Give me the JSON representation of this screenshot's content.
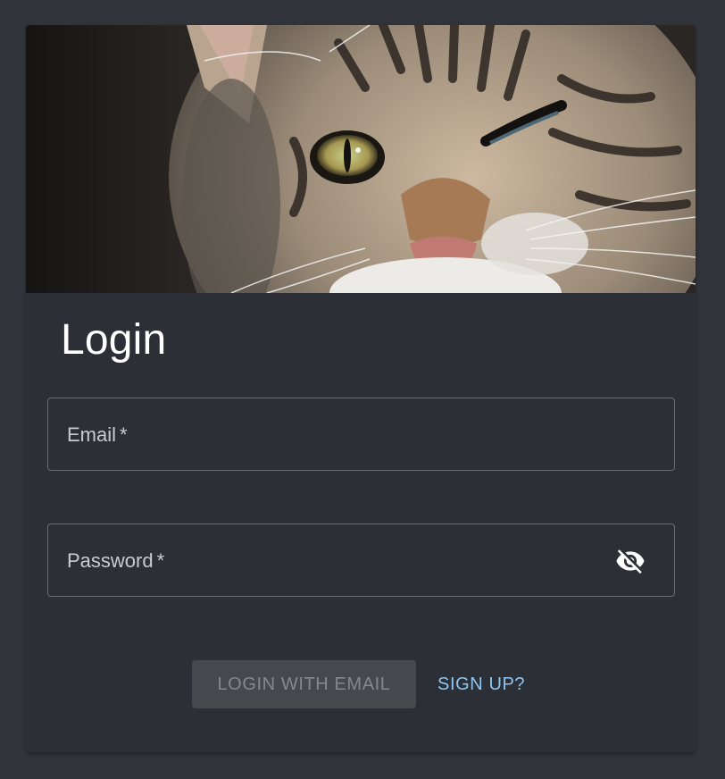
{
  "card": {
    "image_alt": "Close-up photo of a tabby cat"
  },
  "login": {
    "title": "Login",
    "email_label": "Email",
    "password_label": "Password",
    "required_marker": "*",
    "visibility_icon": "visibility-off-icon",
    "login_button_label": "LOGIN WITH EMAIL",
    "signup_button_label": "SIGN UP?"
  },
  "colors": {
    "background": "#31353b",
    "card": "#2c2f35",
    "outline": "#6a6d72",
    "link": "#8fc6f4",
    "disabled_button": "#45484d"
  }
}
